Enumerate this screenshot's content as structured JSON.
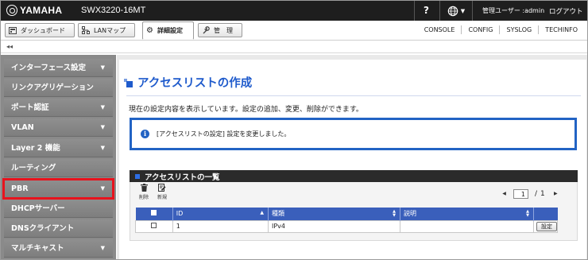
{
  "header": {
    "brand": "YAMAHA",
    "model": "SWX3220-16MT",
    "help_label": "?",
    "user_label": "管理ユーザー :admin",
    "logout_label": "ログアウト"
  },
  "tabs": [
    {
      "label": "ダッシュボード",
      "icon": "dashboard-icon"
    },
    {
      "label": "LANマップ",
      "icon": "lan-map-icon"
    },
    {
      "label": "詳細設定",
      "icon": "gear-icon",
      "active": true
    },
    {
      "label": "管　理",
      "icon": "wrench-icon"
    }
  ],
  "top_links": [
    "CONSOLE",
    "CONFIG",
    "SYSLOG",
    "TECHINFO"
  ],
  "collapse_label": "◂◂",
  "sidebar": {
    "items": [
      {
        "label": "インターフェース設定",
        "has_arrow": true
      },
      {
        "label": "リンクアグリゲーション",
        "has_arrow": false
      },
      {
        "label": "ポート認証",
        "has_arrow": true
      },
      {
        "label": "VLAN",
        "has_arrow": true
      },
      {
        "label": "Layer 2 機能",
        "has_arrow": true
      },
      {
        "label": "ルーティング",
        "has_arrow": false
      },
      {
        "label": "PBR",
        "has_arrow": true,
        "highlighted": true
      },
      {
        "label": "DHCPサーバー",
        "has_arrow": false
      },
      {
        "label": "DNSクライアント",
        "has_arrow": false
      },
      {
        "label": "マルチキャスト",
        "has_arrow": true
      }
    ],
    "arrow_glyph": "▼"
  },
  "main": {
    "title": "アクセスリストの作成",
    "description": "現在の設定内容を表示しています。設定の追加、変更、削除ができます。",
    "notice": "[アクセスリストの設定] 設定を変更しました。",
    "panel_title": "アクセスリストの一覧",
    "actions": {
      "delete": "削除",
      "new": "新規"
    },
    "pager": {
      "current": "1",
      "separator": "/",
      "total": "1",
      "prev": "◀",
      "next": "▶"
    },
    "table": {
      "columns": [
        "ID",
        "種類",
        "説明"
      ],
      "rows": [
        {
          "id": "1",
          "type": "IPv4",
          "description": "",
          "button": "設定"
        }
      ]
    }
  },
  "colors": {
    "accent": "#1f5bcc",
    "table_header": "#3a5fbb",
    "highlight": "#e8131d",
    "topbar": "#1e1e1e"
  }
}
